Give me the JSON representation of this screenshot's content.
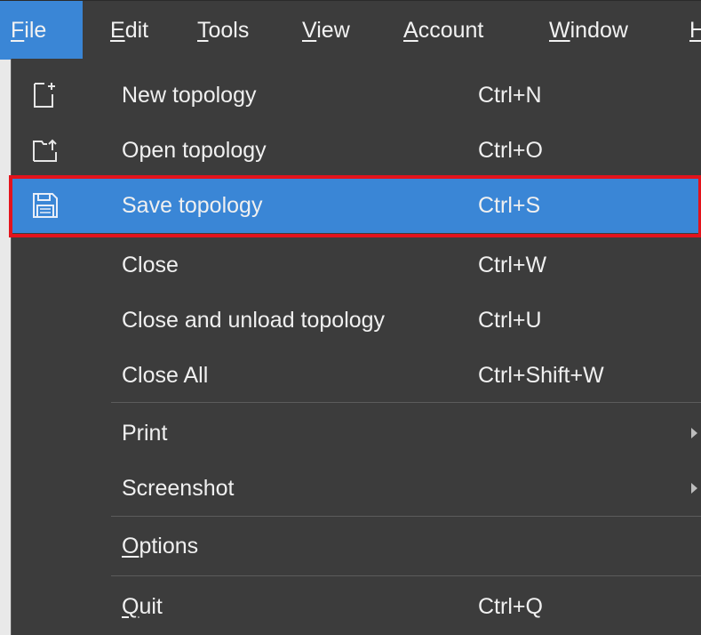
{
  "menubar": {
    "items": [
      {
        "mnemonic": "F",
        "rest": "ile"
      },
      {
        "mnemonic": "E",
        "rest": "dit"
      },
      {
        "mnemonic": "T",
        "rest": "ools"
      },
      {
        "mnemonic": "V",
        "rest": "iew"
      },
      {
        "mnemonic": "A",
        "rest": "ccount"
      },
      {
        "mnemonic": "W",
        "rest": "indow"
      },
      {
        "mnemonic": "H",
        "rest": ""
      }
    ],
    "active_index": 0
  },
  "file_menu": {
    "new_topology": {
      "label": "New topology",
      "shortcut": "Ctrl+N",
      "icon": "new-file-icon"
    },
    "open_topology": {
      "label": "Open topology",
      "shortcut": "Ctrl+O",
      "icon": "open-folder-icon"
    },
    "save_topology": {
      "label": "Save topology",
      "shortcut": "Ctrl+S",
      "icon": "floppy-disk-icon",
      "highlighted": true
    },
    "close": {
      "label": "Close",
      "shortcut": "Ctrl+W"
    },
    "close_unload": {
      "label": "Close and unload topology",
      "shortcut": "Ctrl+U"
    },
    "close_all": {
      "label": "Close All",
      "shortcut": "Ctrl+Shift+W"
    },
    "print": {
      "label": "Print",
      "submenu": true
    },
    "screenshot": {
      "label": "Screenshot",
      "submenu": true
    },
    "options": {
      "mnemonic": "O",
      "rest": "ptions"
    },
    "quit": {
      "mnemonic": "Q",
      "rest": "uit",
      "shortcut": "Ctrl+Q"
    }
  },
  "colors": {
    "menu_bg": "#3c3c3c",
    "highlight": "#3a86d6",
    "annotation_frame": "#e3131c",
    "text": "#f0f0f0"
  }
}
